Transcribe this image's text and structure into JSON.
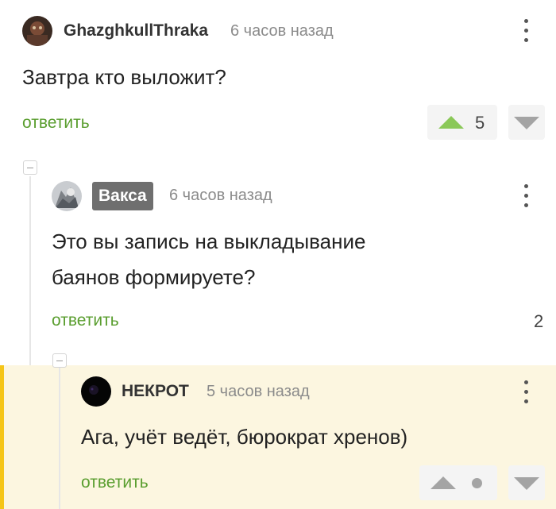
{
  "comments": [
    {
      "username": "GhazghkullThraka",
      "time": "6 часов назад",
      "text": "Завтра кто выложит?",
      "reply_label": "ответить",
      "rating": "5"
    },
    {
      "username": "Вакса",
      "time": "6 часов назад",
      "text_line1": "Это вы запись на выкладывание",
      "text_line2": "баянов формируете?",
      "reply_label": "ответить",
      "rating": "2"
    },
    {
      "username": "НЕКРОТ",
      "time": "5 часов назад",
      "text": "Ага, учёт ведёт, бюрократ хренов)",
      "reply_label": "ответить"
    }
  ],
  "colors": {
    "reply_link": "#5a9e2f",
    "upvote_active": "#8ac858",
    "highlight_background": "#fcf6e0",
    "highlight_bar": "#f5c518",
    "badge_background": "#6f6f6f"
  },
  "icons": {
    "menu": "more-vertical-icon",
    "upvote": "arrow-up-icon",
    "downvote": "arrow-down-icon",
    "collapse": "minus-square-icon"
  }
}
